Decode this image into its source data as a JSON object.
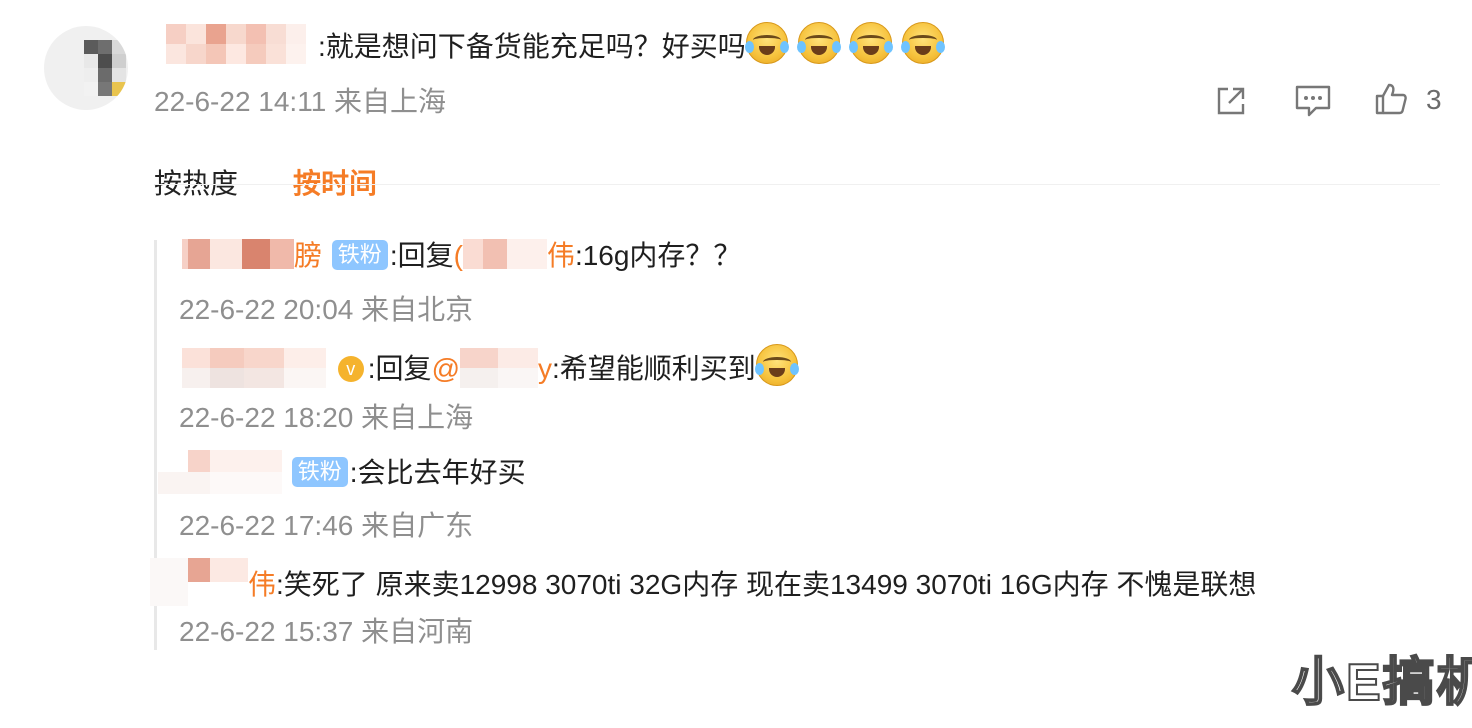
{
  "main_comment": {
    "text": ":就是想问下备货能充足吗？好买吗",
    "emoji_count_label": "4",
    "date": "22-6-22 14:11 来自上海",
    "like_count": "3"
  },
  "sort_tabs": {
    "hot": "按热度",
    "time": "按时间"
  },
  "replies": [
    {
      "name_tail": "膀",
      "badge": "铁粉",
      "reply_prefix": ":回复",
      "reply_target_open": "(",
      "reply_target_tail": "伟",
      "text": ":16g内存？？",
      "date": "22-6-22 20:04 来自北京"
    },
    {
      "badge_v": "v",
      "reply_prefix": ":回复",
      "reply_target_at": "@",
      "reply_target_tail": "y",
      "text": ":希望能顺利买到",
      "date": "22-6-22 18:20 来自上海"
    },
    {
      "badge": "铁粉",
      "text": ":会比去年好买",
      "date": "22-6-22 17:46 来自广东"
    },
    {
      "name_tail": "伟",
      "text": ":笑死了 原来卖12998  3070ti 32G内存   现在卖13499  3070ti  16G内存  不愧是联想",
      "date": "22-6-22 15:37 来自河南"
    }
  ],
  "watermark": "小E搞机",
  "icons": [
    "share-icon",
    "comment-icon",
    "like-icon",
    "laugh-cry-emoji"
  ]
}
